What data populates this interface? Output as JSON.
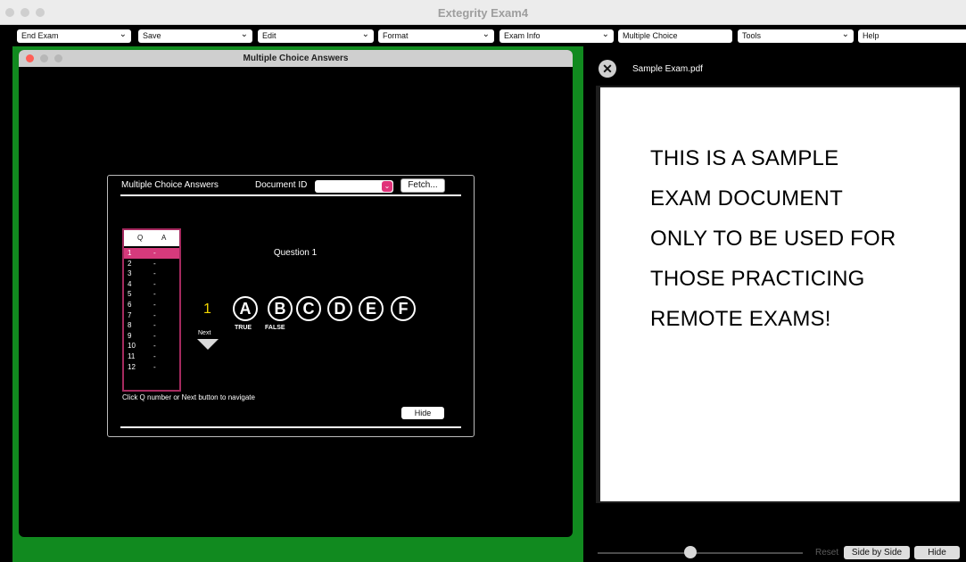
{
  "app": {
    "title": "Extegrity Exam4"
  },
  "toolbar": {
    "items": [
      {
        "label": "End Exam",
        "has_dropdown": true
      },
      {
        "label": "Save",
        "has_dropdown": true
      },
      {
        "label": "Edit",
        "has_dropdown": true
      },
      {
        "label": "Format",
        "has_dropdown": true
      },
      {
        "label": "Exam Info",
        "has_dropdown": true
      },
      {
        "label": "Multiple Choice",
        "has_dropdown": false
      },
      {
        "label": "Tools",
        "has_dropdown": true
      },
      {
        "label": "Help",
        "has_dropdown": false
      }
    ]
  },
  "mc_window": {
    "title": "Multiple Choice Answers",
    "dialog": {
      "heading": "Multiple Choice Answers",
      "document_id_label": "Document ID",
      "document_id_value": "",
      "fetch_label": "Fetch...",
      "qa_header": {
        "q": "Q",
        "a": "A"
      },
      "qa_rows": [
        {
          "q": "1",
          "a": "-"
        },
        {
          "q": "2",
          "a": "-"
        },
        {
          "q": "3",
          "a": "-"
        },
        {
          "q": "4",
          "a": "-"
        },
        {
          "q": "5",
          "a": "-"
        },
        {
          "q": "6",
          "a": "-"
        },
        {
          "q": "7",
          "a": "-"
        },
        {
          "q": "8",
          "a": "-"
        },
        {
          "q": "9",
          "a": "-"
        },
        {
          "q": "10",
          "a": "-"
        },
        {
          "q": "11",
          "a": "-"
        },
        {
          "q": "12",
          "a": "-"
        }
      ],
      "selected_row": 0,
      "question_label": "Question 1",
      "question_number": "1",
      "next_label": "Next",
      "choices": [
        "A",
        "B",
        "C",
        "D",
        "E",
        "F"
      ],
      "choice_labels": [
        "TRUE",
        "FALSE"
      ],
      "hint": "Click Q number or Next button to navigate",
      "hide_label": "Hide"
    }
  },
  "pdf_viewer": {
    "file_name": "Sample Exam.pdf",
    "page_lines": [
      "THIS IS A SAMPLE",
      "EXAM DOCUMENT",
      "ONLY TO BE USED FOR",
      "THOSE PRACTICING",
      "REMOTE EXAMS!"
    ],
    "zoom_level": 0.45,
    "reset_label": "Reset",
    "side_by_side_label": "Side by Side",
    "hide_label": "Hide"
  },
  "colors": {
    "frame_green": "#118a1f",
    "accent_pink": "#d63a7c",
    "question_number_yellow": "#f2d600"
  }
}
